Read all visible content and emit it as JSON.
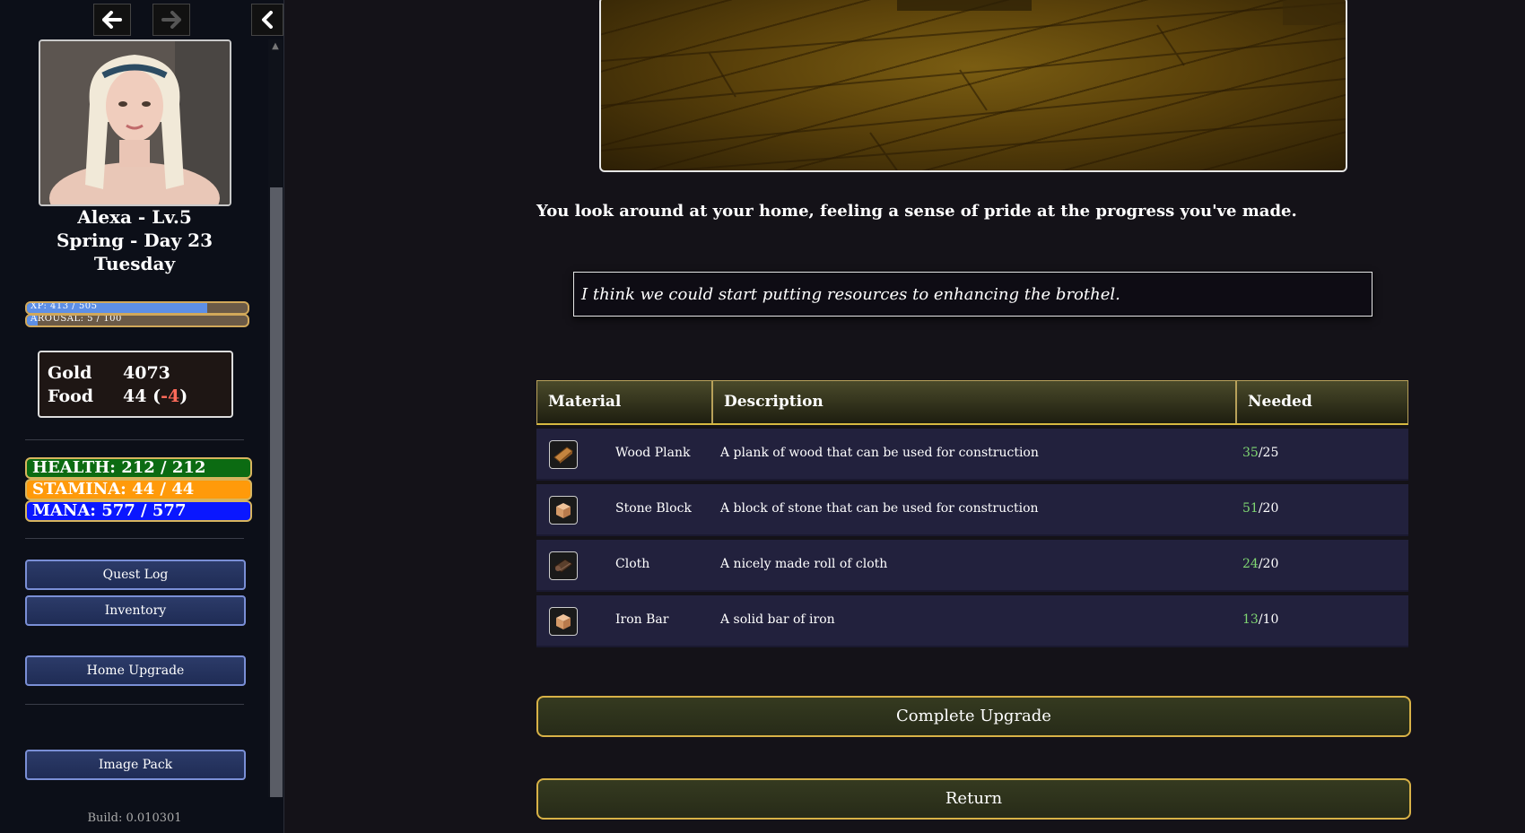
{
  "sidebar": {
    "character": {
      "name_level": "Alexa - Lv.5",
      "season_day": "Spring - Day 23",
      "weekday": "Tuesday"
    },
    "bars": {
      "xp": {
        "label": "XP: 413 / 505",
        "fraction": 0.818
      },
      "arousal": {
        "label": "AROUSAL: 5 / 100",
        "fraction": 0.05
      }
    },
    "resources": {
      "gold_label": "Gold",
      "gold_value": "4073",
      "food_label": "Food",
      "food_value": "44",
      "food_open": "(",
      "food_delta": "-4",
      "food_close": ")"
    },
    "stats": {
      "health": "HEALTH: 212 / 212",
      "stamina": "STAMINA: 44 / 44",
      "mana": "MANA: 577 / 577"
    },
    "buttons": {
      "quest_log": "Quest Log",
      "inventory": "Inventory",
      "home_upgrade": "Home Upgrade",
      "image_pack": "Image Pack"
    },
    "build": "Build: 0.010301"
  },
  "main": {
    "narration": "You look around at your home, feeling a sense of pride at the progress you've made.",
    "dialogue": "I think we could start putting resources to enhancing the brothel.",
    "table": {
      "headers": {
        "material": "Material",
        "description": "Description",
        "needed": "Needed"
      },
      "rows": [
        {
          "icon": "wood-plank-icon",
          "name": "Wood Plank",
          "description": "A plank of wood that can be used for construction",
          "have": "35",
          "need": "/25"
        },
        {
          "icon": "stone-block-icon",
          "name": "Stone Block",
          "description": "A block of stone that can be used for construction",
          "have": "51",
          "need": "/20"
        },
        {
          "icon": "cloth-icon",
          "name": "Cloth",
          "description": "A nicely made roll of cloth",
          "have": "24",
          "need": "/20"
        },
        {
          "icon": "iron-bar-icon",
          "name": "Iron Bar",
          "description": "A solid bar of iron",
          "have": "13",
          "need": "/10"
        }
      ]
    },
    "buttons": {
      "complete": "Complete Upgrade",
      "return": "Return"
    }
  },
  "colors": {
    "health": "#0c6b12",
    "stamina": "#ff9a0a",
    "mana": "#0a17ff",
    "xp_fill": "#5d8fe6",
    "have_green": "#7fd672",
    "negative": "#ff6a5a",
    "gold_border": "#d8b247"
  }
}
